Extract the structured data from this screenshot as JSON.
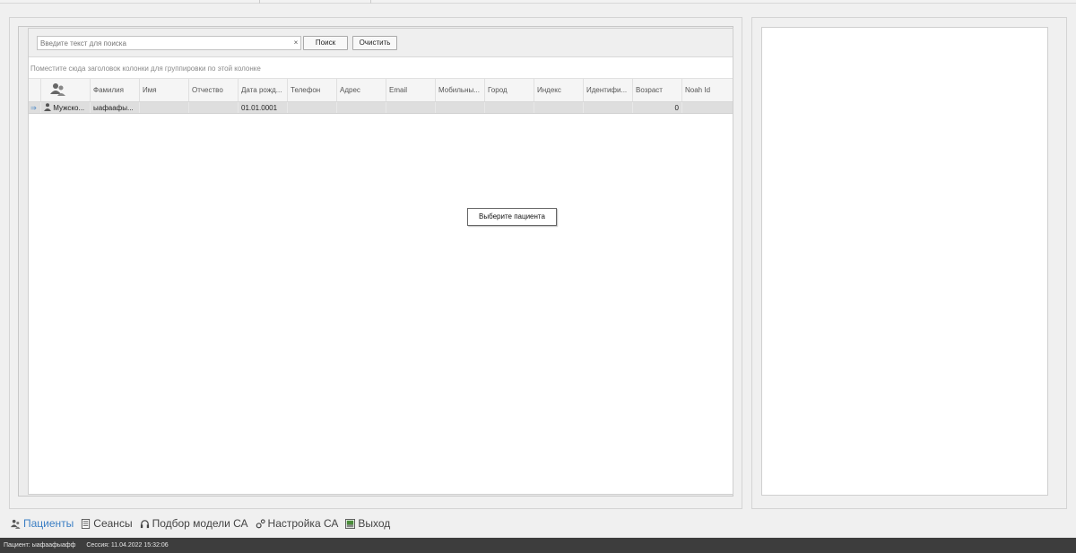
{
  "search": {
    "placeholder": "Введите текст для поиска",
    "clear_glyph": "×",
    "search_button": "Поиск",
    "clear_button": "Очистить"
  },
  "grid": {
    "group_hint": "Поместите сюда заголовок колонки для группировки по этой колонке",
    "columns": [
      "Фамилия",
      "Имя",
      "Отчество",
      "Дата рожд...",
      "Телефон",
      "Адрес",
      "Email",
      "Мобильны...",
      "Город",
      "Индекс",
      "Идентифи...",
      "Возраст",
      "Noah Id"
    ],
    "rows": [
      {
        "gender": "Мужско...",
        "surname": "ыафаафы...",
        "name": "",
        "patronymic": "",
        "birth_date": "01.01.0001",
        "phone": "",
        "address": "",
        "email": "",
        "mobile": "",
        "city": "",
        "index": "",
        "identifier": "",
        "age": "0",
        "noah_id": ""
      }
    ]
  },
  "tooltip": "Выберите пациента",
  "nav": {
    "patients": "Пациенты",
    "sessions": "Сеансы",
    "model_selection": "Подбор модели СА",
    "settings": "Настройка СА",
    "exit": "Выход"
  },
  "status": {
    "patient": "Пациент: ыафаафыафф",
    "session": "Сессия: 11.04.2022 15:32:06"
  },
  "colors": {
    "accent": "#3c7fc4",
    "statusbar": "#3d3d3d"
  }
}
